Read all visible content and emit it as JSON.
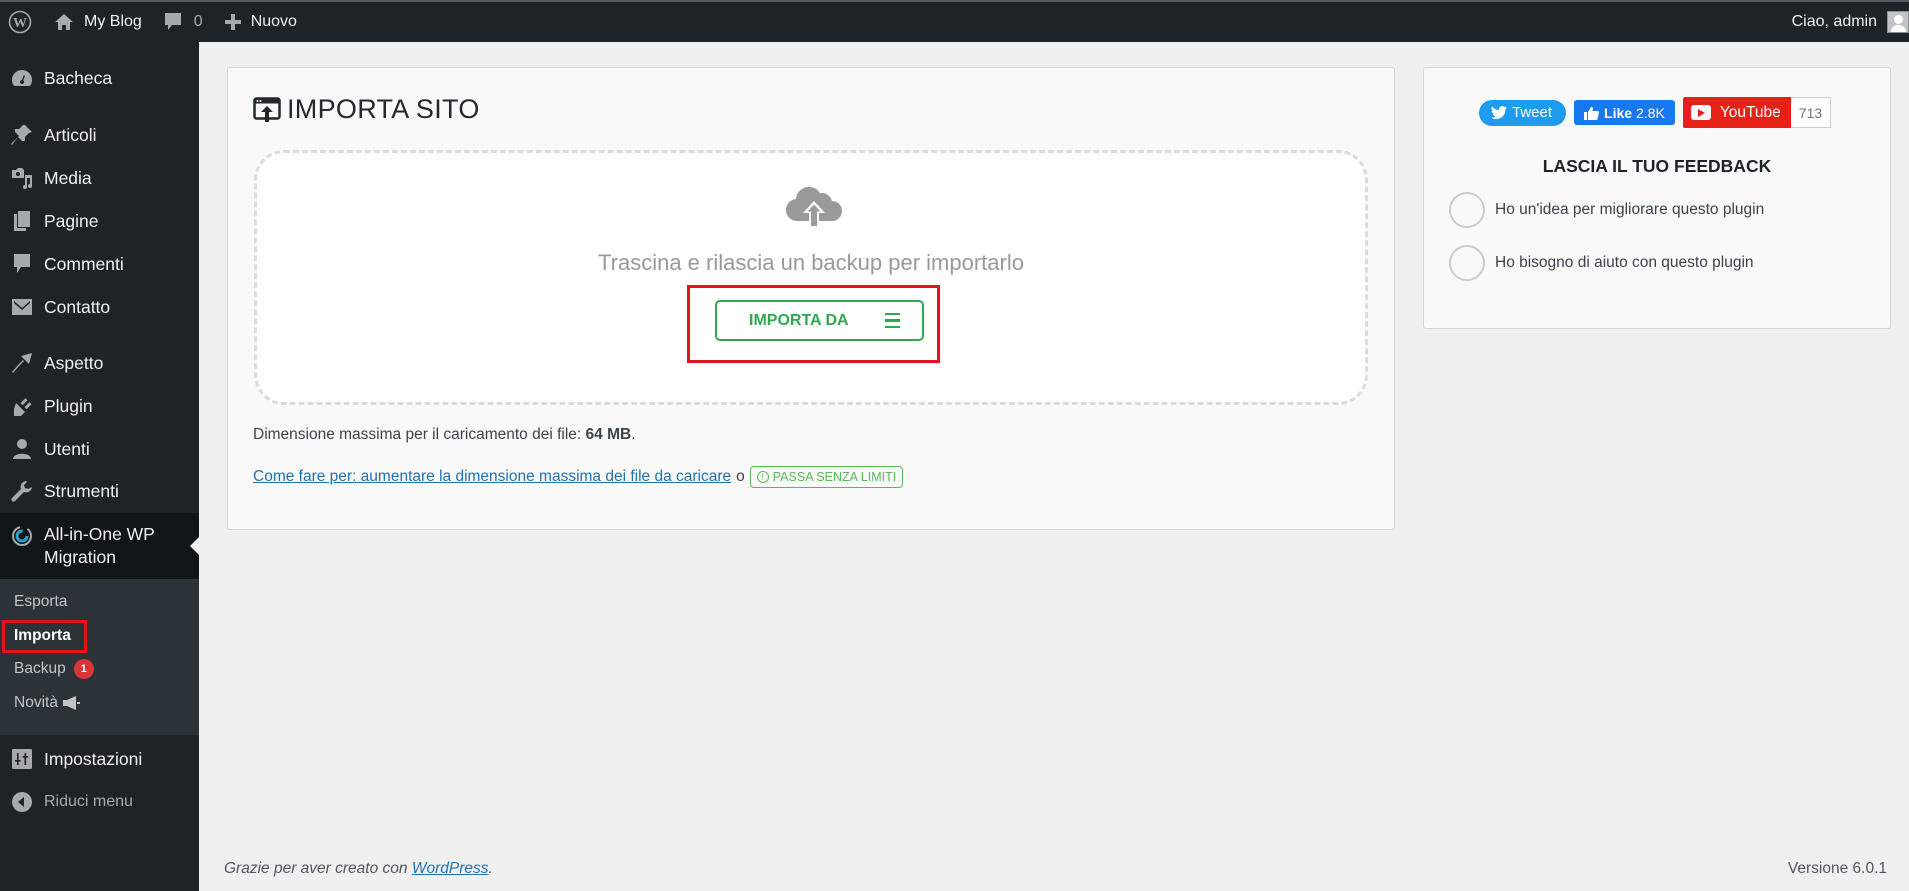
{
  "adminbar": {
    "site_name": "My Blog",
    "comments_count": "0",
    "new_label": "Nuovo",
    "greeting": "Ciao, admin"
  },
  "sidebar": {
    "items": [
      {
        "label": "Bacheca",
        "icon": "dashboard-icon"
      },
      {
        "label": "Articoli",
        "icon": "pin-icon"
      },
      {
        "label": "Media",
        "icon": "media-icon"
      },
      {
        "label": "Pagine",
        "icon": "pages-icon"
      },
      {
        "label": "Commenti",
        "icon": "comment-icon"
      },
      {
        "label": "Contatto",
        "icon": "mail-icon"
      },
      {
        "label": "Aspetto",
        "icon": "brush-icon"
      },
      {
        "label": "Plugin",
        "icon": "plugin-icon"
      },
      {
        "label": "Utenti",
        "icon": "user-icon"
      },
      {
        "label": "Strumenti",
        "icon": "wrench-icon"
      },
      {
        "label": "All-in-One WP Migration",
        "icon": "migration-icon"
      },
      {
        "label": "Impostazioni",
        "icon": "settings-icon"
      }
    ],
    "submenu": [
      {
        "label": "Esporta"
      },
      {
        "label": "Importa"
      },
      {
        "label": "Backup",
        "badge": "1"
      },
      {
        "label": "Novità",
        "icon": "megaphone-icon"
      }
    ],
    "collapse_label": "Riduci menu"
  },
  "main": {
    "title": "IMPORTA SITO",
    "drop_text": "Trascina e rilascia un backup per importarlo",
    "import_button": "IMPORTA DA",
    "max_size_label": "Dimensione massima per il caricamento dei file:",
    "max_size_value": "64 MB",
    "howto_link": "Come fare per: aumentare la dimensione massima dei file da caricare",
    "or_text": "o",
    "unlimited_button": "PASSA SENZA LIMITI"
  },
  "side": {
    "tweet_label": "Tweet",
    "like_label": "Like",
    "like_count": "2.8K",
    "youtube_label": "YouTube",
    "youtube_count": "713",
    "feedback_title": "LASCIA IL TUO FEEDBACK",
    "feedback_options": [
      "Ho un'idea per migliorare questo plugin",
      "Ho bisogno di aiuto con questo plugin"
    ]
  },
  "footer": {
    "thanks_prefix": "Grazie per aver creato con",
    "wordpress_link": "WordPress",
    "version": "Versione 6.0.1"
  },
  "colors": {
    "accent_green": "#2fa84f",
    "highlight_red": "#e3131e",
    "link_blue": "#2271b1",
    "adminbar_bg": "#1d2327"
  }
}
